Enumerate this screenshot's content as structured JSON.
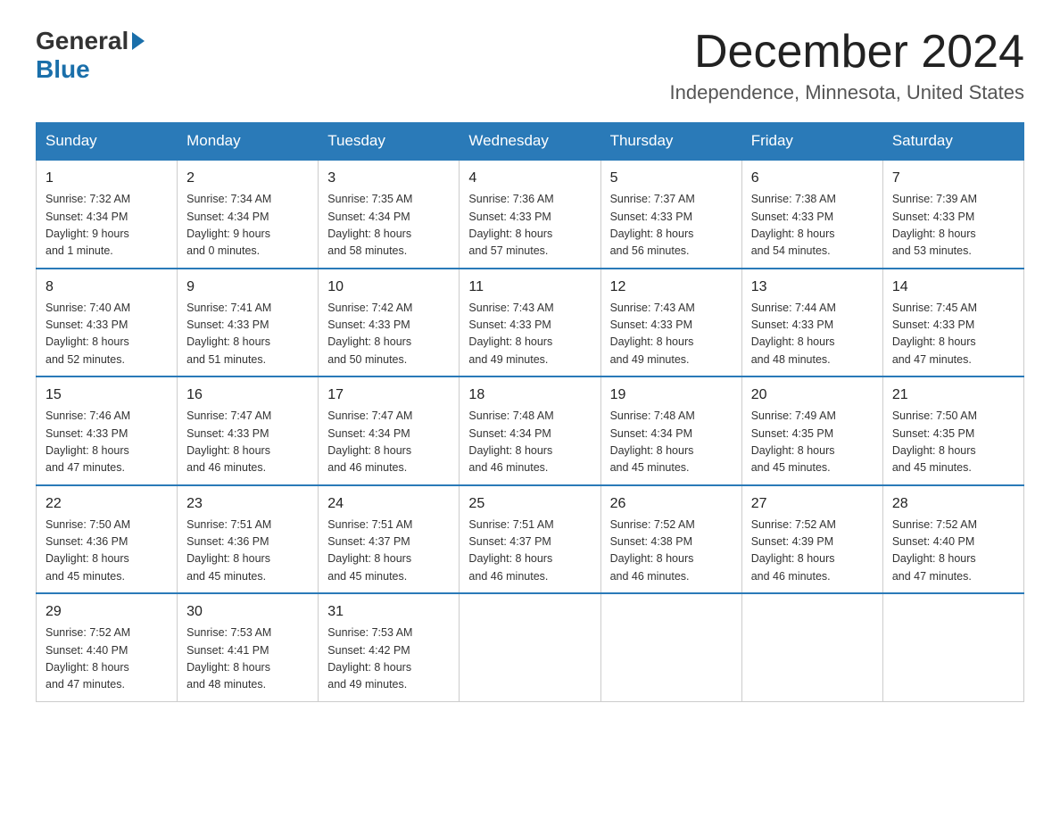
{
  "header": {
    "logo_general": "General",
    "logo_blue": "Blue",
    "month_year": "December 2024",
    "location": "Independence, Minnesota, United States"
  },
  "days_of_week": [
    "Sunday",
    "Monday",
    "Tuesday",
    "Wednesday",
    "Thursday",
    "Friday",
    "Saturday"
  ],
  "weeks": [
    [
      {
        "day": "1",
        "sunrise": "7:32 AM",
        "sunset": "4:34 PM",
        "daylight": "9 hours and 1 minute."
      },
      {
        "day": "2",
        "sunrise": "7:34 AM",
        "sunset": "4:34 PM",
        "daylight": "9 hours and 0 minutes."
      },
      {
        "day": "3",
        "sunrise": "7:35 AM",
        "sunset": "4:34 PM",
        "daylight": "8 hours and 58 minutes."
      },
      {
        "day": "4",
        "sunrise": "7:36 AM",
        "sunset": "4:33 PM",
        "daylight": "8 hours and 57 minutes."
      },
      {
        "day": "5",
        "sunrise": "7:37 AM",
        "sunset": "4:33 PM",
        "daylight": "8 hours and 56 minutes."
      },
      {
        "day": "6",
        "sunrise": "7:38 AM",
        "sunset": "4:33 PM",
        "daylight": "8 hours and 54 minutes."
      },
      {
        "day": "7",
        "sunrise": "7:39 AM",
        "sunset": "4:33 PM",
        "daylight": "8 hours and 53 minutes."
      }
    ],
    [
      {
        "day": "8",
        "sunrise": "7:40 AM",
        "sunset": "4:33 PM",
        "daylight": "8 hours and 52 minutes."
      },
      {
        "day": "9",
        "sunrise": "7:41 AM",
        "sunset": "4:33 PM",
        "daylight": "8 hours and 51 minutes."
      },
      {
        "day": "10",
        "sunrise": "7:42 AM",
        "sunset": "4:33 PM",
        "daylight": "8 hours and 50 minutes."
      },
      {
        "day": "11",
        "sunrise": "7:43 AM",
        "sunset": "4:33 PM",
        "daylight": "8 hours and 49 minutes."
      },
      {
        "day": "12",
        "sunrise": "7:43 AM",
        "sunset": "4:33 PM",
        "daylight": "8 hours and 49 minutes."
      },
      {
        "day": "13",
        "sunrise": "7:44 AM",
        "sunset": "4:33 PM",
        "daylight": "8 hours and 48 minutes."
      },
      {
        "day": "14",
        "sunrise": "7:45 AM",
        "sunset": "4:33 PM",
        "daylight": "8 hours and 47 minutes."
      }
    ],
    [
      {
        "day": "15",
        "sunrise": "7:46 AM",
        "sunset": "4:33 PM",
        "daylight": "8 hours and 47 minutes."
      },
      {
        "day": "16",
        "sunrise": "7:47 AM",
        "sunset": "4:33 PM",
        "daylight": "8 hours and 46 minutes."
      },
      {
        "day": "17",
        "sunrise": "7:47 AM",
        "sunset": "4:34 PM",
        "daylight": "8 hours and 46 minutes."
      },
      {
        "day": "18",
        "sunrise": "7:48 AM",
        "sunset": "4:34 PM",
        "daylight": "8 hours and 46 minutes."
      },
      {
        "day": "19",
        "sunrise": "7:48 AM",
        "sunset": "4:34 PM",
        "daylight": "8 hours and 45 minutes."
      },
      {
        "day": "20",
        "sunrise": "7:49 AM",
        "sunset": "4:35 PM",
        "daylight": "8 hours and 45 minutes."
      },
      {
        "day": "21",
        "sunrise": "7:50 AM",
        "sunset": "4:35 PM",
        "daylight": "8 hours and 45 minutes."
      }
    ],
    [
      {
        "day": "22",
        "sunrise": "7:50 AM",
        "sunset": "4:36 PM",
        "daylight": "8 hours and 45 minutes."
      },
      {
        "day": "23",
        "sunrise": "7:51 AM",
        "sunset": "4:36 PM",
        "daylight": "8 hours and 45 minutes."
      },
      {
        "day": "24",
        "sunrise": "7:51 AM",
        "sunset": "4:37 PM",
        "daylight": "8 hours and 45 minutes."
      },
      {
        "day": "25",
        "sunrise": "7:51 AM",
        "sunset": "4:37 PM",
        "daylight": "8 hours and 46 minutes."
      },
      {
        "day": "26",
        "sunrise": "7:52 AM",
        "sunset": "4:38 PM",
        "daylight": "8 hours and 46 minutes."
      },
      {
        "day": "27",
        "sunrise": "7:52 AM",
        "sunset": "4:39 PM",
        "daylight": "8 hours and 46 minutes."
      },
      {
        "day": "28",
        "sunrise": "7:52 AM",
        "sunset": "4:40 PM",
        "daylight": "8 hours and 47 minutes."
      }
    ],
    [
      {
        "day": "29",
        "sunrise": "7:52 AM",
        "sunset": "4:40 PM",
        "daylight": "8 hours and 47 minutes."
      },
      {
        "day": "30",
        "sunrise": "7:53 AM",
        "sunset": "4:41 PM",
        "daylight": "8 hours and 48 minutes."
      },
      {
        "day": "31",
        "sunrise": "7:53 AM",
        "sunset": "4:42 PM",
        "daylight": "8 hours and 49 minutes."
      },
      null,
      null,
      null,
      null
    ]
  ],
  "labels": {
    "sunrise": "Sunrise:",
    "sunset": "Sunset:",
    "daylight": "Daylight:"
  }
}
